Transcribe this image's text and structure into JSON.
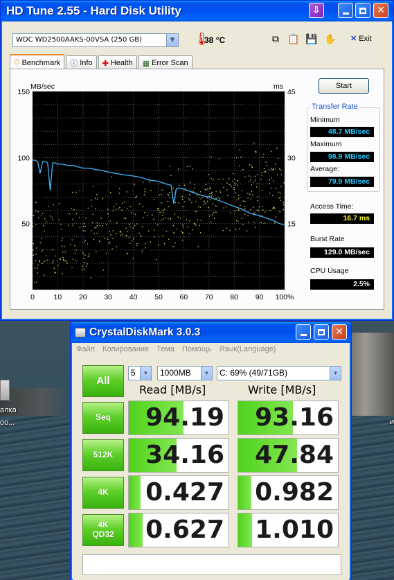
{
  "desktop": {
    "left_label_1": "алка",
    "left_label_2": "оо...",
    "right_label": "и"
  },
  "hdtune": {
    "title": "HD Tune 2.55 - Hard Disk Utility",
    "drive": "WDC WD2500AAKS-00VSA (250 GB)",
    "temperature": "38 °C",
    "exit_label": "Exit",
    "tabs": [
      {
        "label": "Benchmark",
        "icon": "stopwatch-icon"
      },
      {
        "label": "Info",
        "icon": "info-icon"
      },
      {
        "label": "Health",
        "icon": "health-cross-icon"
      },
      {
        "label": "Error Scan",
        "icon": "error-scan-icon"
      }
    ],
    "start_label": "Start",
    "transfer_rate_label": "Transfer Rate",
    "minimum_label": "Minimum",
    "minimum_value": "48.7 MB/sec",
    "maximum_label": "Maximum",
    "maximum_value": "98.9 MB/sec",
    "average_label": "Average:",
    "average_value": "79.9 MB/sec",
    "access_time_label": "Access Time:",
    "access_time_value": "16.7 ms",
    "burst_rate_label": "Burst Rate",
    "burst_rate_value": "129.0 MB/sec",
    "cpu_usage_label": "CPU Usage",
    "cpu_usage_value": "2.5%",
    "colors": {
      "transfer_line": "#3fb8ff",
      "access_dots": "#e8e860",
      "plot_bg": "#000000"
    }
  },
  "chart_data": {
    "type": "line",
    "ylabel": "MB/sec",
    "y2label": "ms",
    "xlim": [
      0,
      100
    ],
    "ylim": [
      0,
      150
    ],
    "y2lim": [
      0,
      45
    ],
    "x_ticks": [
      "0",
      "10",
      "20",
      "30",
      "40",
      "50",
      "60",
      "70",
      "80",
      "90",
      "100%"
    ],
    "y_ticks": [
      "50",
      "100",
      "150"
    ],
    "y2_ticks": [
      "15",
      "30",
      "45"
    ],
    "grid": true,
    "series": [
      {
        "x": [
          0,
          1,
          2,
          3,
          4,
          5,
          6,
          7,
          8,
          9,
          10,
          12,
          14,
          16,
          18,
          20,
          22,
          25,
          28,
          30,
          33,
          36,
          40,
          43,
          46,
          50,
          53,
          55,
          56,
          57,
          58,
          60,
          63,
          66,
          70,
          73,
          76,
          80,
          83,
          86,
          90,
          93,
          96,
          98,
          100
        ],
        "y": [
          98,
          98,
          97,
          88,
          97,
          97,
          96,
          75,
          96,
          96,
          95,
          95,
          94,
          94,
          93,
          92,
          92,
          91,
          90,
          89,
          88,
          87,
          86,
          85,
          83,
          82,
          80,
          79,
          65,
          76,
          77,
          76,
          74,
          72,
          70,
          68,
          66,
          63,
          61,
          58,
          56,
          54,
          52,
          50,
          49
        ]
      }
    ],
    "access_time_scatter": "random yellow dots spread roughly 8–33 ms, rising with position"
  },
  "cdm": {
    "title": "CrystalDiskMark 3.0.3",
    "menu": [
      "Файл",
      "Копирование",
      "Тема",
      "Помощь",
      "Язык(Language)"
    ],
    "all_label": "All",
    "count_value": "5",
    "size_value": "1000MB",
    "drive_value": "C: 69% (49/71GB)",
    "read_header": "Read [MB/s]",
    "write_header": "Write [MB/s]",
    "rows": [
      {
        "label_1": "Seq",
        "label_2": "",
        "read": "94.19",
        "write": "93.16",
        "read_level": 0.55,
        "write_level": 0.55
      },
      {
        "label_1": "512K",
        "label_2": "",
        "read": "34.16",
        "write": "47.84",
        "read_level": 0.48,
        "write_level": 0.59
      },
      {
        "label_1": "4K",
        "label_2": "",
        "read": "0.427",
        "write": "0.982",
        "read_level": 0.12,
        "write_level": 0.13
      },
      {
        "label_1": "4K",
        "label_2": "QD32",
        "read": "0.627",
        "write": "1.010",
        "read_level": 0.14,
        "write_level": 0.14
      }
    ],
    "status_text": ""
  }
}
